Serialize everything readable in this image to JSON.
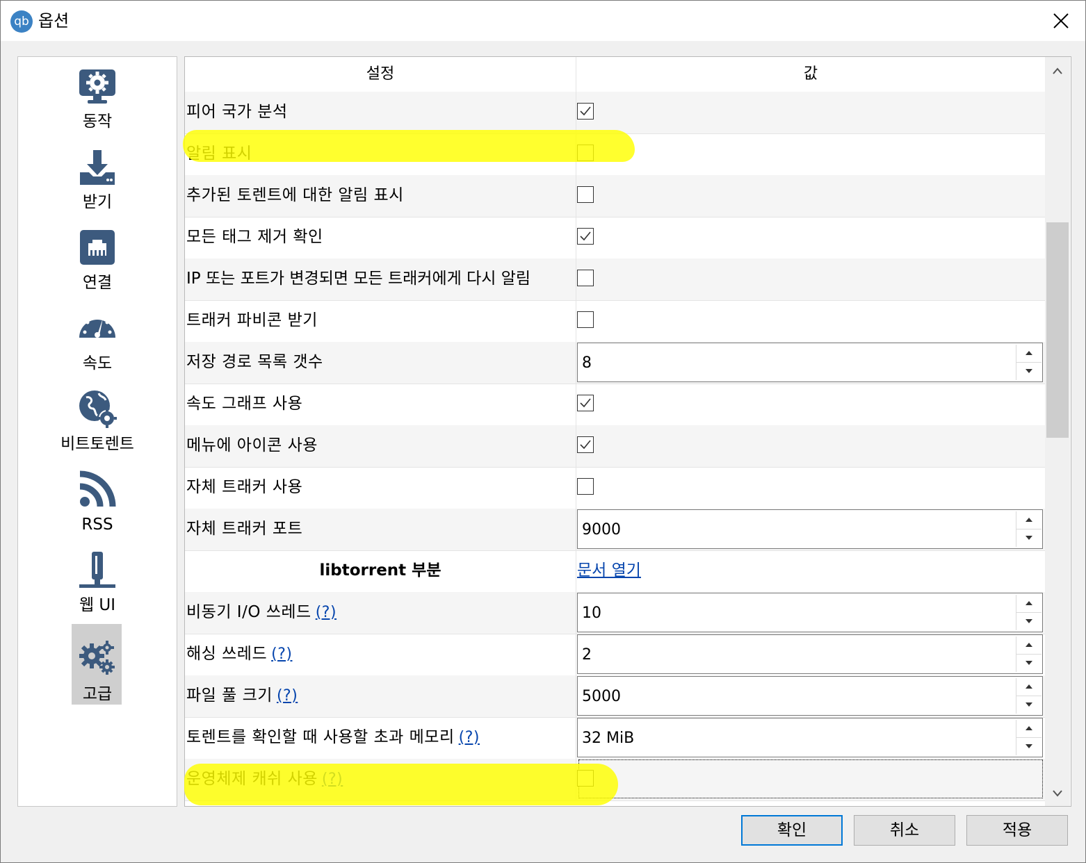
{
  "window": {
    "title": "옵션",
    "app_icon_text": "qb"
  },
  "sidebar": {
    "items": [
      {
        "label": "동작",
        "icon": "behavior-monitor-gear-icon"
      },
      {
        "label": "받기",
        "icon": "download-icon"
      },
      {
        "label": "연결",
        "icon": "network-port-icon"
      },
      {
        "label": "속도",
        "icon": "speedometer-icon"
      },
      {
        "label": "비트토렌트",
        "icon": "globe-gear-icon"
      },
      {
        "label": "RSS",
        "icon": "rss-icon"
      },
      {
        "label": "웹 UI",
        "icon": "web-ui-icon"
      },
      {
        "label": "고급",
        "icon": "advanced-gears-icon"
      }
    ],
    "selected": "고급"
  },
  "table": {
    "headers": {
      "setting": "설정",
      "value": "값"
    },
    "rows": [
      {
        "name": "피어 국가 분석",
        "type": "checkbox",
        "checked": true
      },
      {
        "name": "알림 표시",
        "type": "checkbox",
        "checked": false
      },
      {
        "name": "추가된 토렌트에 대한 알림 표시",
        "type": "checkbox",
        "checked": false
      },
      {
        "name": "모든 태그 제거 확인",
        "type": "checkbox",
        "checked": true
      },
      {
        "name": "IP 또는 포트가 변경되면 모든 트래커에게 다시 알림",
        "type": "checkbox",
        "checked": false
      },
      {
        "name": "트래커 파비콘 받기",
        "type": "checkbox",
        "checked": false
      },
      {
        "name": "저장 경로 목록 갯수",
        "type": "spin",
        "value": "8"
      },
      {
        "name": "속도 그래프 사용",
        "type": "checkbox",
        "checked": true
      },
      {
        "name": "메뉴에 아이콘 사용",
        "type": "checkbox",
        "checked": true
      },
      {
        "name": "자체 트래커 사용",
        "type": "checkbox",
        "checked": false
      },
      {
        "name": "자체 트래커 포트",
        "type": "spin",
        "value": "9000"
      },
      {
        "name": "libtorrent 부분",
        "type": "section",
        "link": "문서 열기"
      },
      {
        "name": "비동기 I/O 쓰레드",
        "help": "(?)",
        "type": "spin",
        "value": "10"
      },
      {
        "name": "해싱 쓰레드",
        "help": "(?)",
        "type": "spin",
        "value": "2"
      },
      {
        "name": "파일 풀 크기",
        "help": "(?)",
        "type": "spin",
        "value": "5000"
      },
      {
        "name": "토렌트를 확인할 때 사용할 초과 메모리",
        "help": "(?)",
        "type": "spin",
        "value": "32 MiB"
      },
      {
        "name": "운영체제 캐쉬 사용",
        "help": "(?)",
        "type": "checkbox",
        "checked": false,
        "focused": true
      }
    ]
  },
  "buttons": {
    "ok": "확인",
    "cancel": "취소",
    "apply": "적용"
  },
  "colors": {
    "highlight": "#ffff00",
    "link": "#0645ad",
    "default_button_border": "#0078d7",
    "icon": "#3c5a7e"
  }
}
